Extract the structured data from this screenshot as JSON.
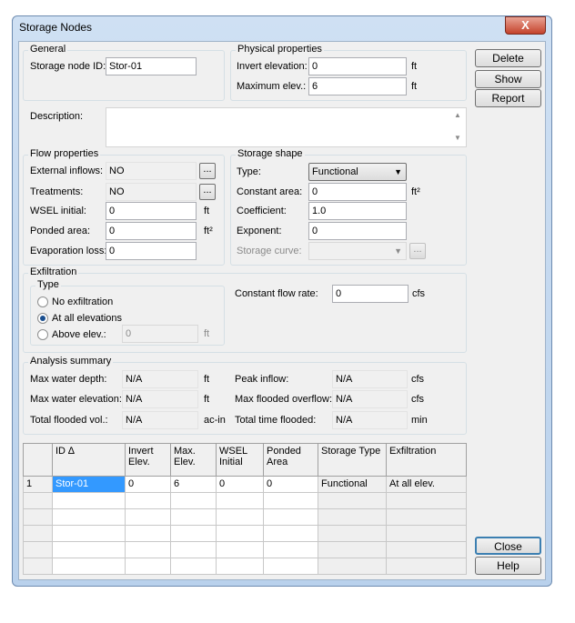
{
  "window": {
    "title": "Storage Nodes",
    "close": "X"
  },
  "general": {
    "legend": "General",
    "id_label": "Storage node ID:",
    "id_value": "Stor-01"
  },
  "physical": {
    "legend": "Physical properties",
    "invert_label": "Invert elevation:",
    "invert_value": "0",
    "invert_unit": "ft",
    "max_label": "Maximum elev.:",
    "max_value": "6",
    "max_unit": "ft"
  },
  "buttons": {
    "delete": "Delete",
    "show": "Show",
    "report": "Report",
    "close": "Close",
    "help": "Help",
    "ellipsis": "..."
  },
  "description": {
    "label": "Description:",
    "value": ""
  },
  "flow": {
    "legend": "Flow properties",
    "ext_label": "External inflows:",
    "ext_value": "NO",
    "treat_label": "Treatments:",
    "treat_value": "NO",
    "wsel_label": "WSEL initial:",
    "wsel_value": "0",
    "wsel_unit": "ft",
    "ponded_label": "Ponded area:",
    "ponded_value": "0",
    "ponded_unit": "ft²",
    "evap_label": "Evaporation loss:",
    "evap_value": "0"
  },
  "shape": {
    "legend": "Storage shape",
    "type_label": "Type:",
    "type_value": "Functional",
    "const_label": "Constant area:",
    "const_value": "0",
    "const_unit": "ft²",
    "coef_label": "Coefficient:",
    "coef_value": "1.0",
    "exp_label": "Exponent:",
    "exp_value": "0",
    "curve_label": "Storage curve:",
    "curve_value": ""
  },
  "exfil": {
    "legend": "Exfiltration",
    "type_legend": "Type",
    "options": [
      "No exfiltration",
      "At all elevations",
      "Above elev.:"
    ],
    "selected": 1,
    "above_value": "0",
    "above_unit": "ft",
    "rate_label": "Constant flow rate:",
    "rate_value": "0",
    "rate_unit": "cfs"
  },
  "summary": {
    "legend": "Analysis summary",
    "depth_label": "Max water depth:",
    "depth_value": "N/A",
    "depth_unit": "ft",
    "elev_label": "Max water elevation:",
    "elev_value": "N/A",
    "elev_unit": "ft",
    "vol_label": "Total flooded vol.:",
    "vol_value": "N/A",
    "vol_unit": "ac-in",
    "peak_label": "Peak inflow:",
    "peak_value": "N/A",
    "peak_unit": "cfs",
    "overflow_label": "Max flooded overflow:",
    "overflow_value": "N/A",
    "overflow_unit": "cfs",
    "time_label": "Total time flooded:",
    "time_value": "N/A",
    "time_unit": "min"
  },
  "grid": {
    "headers": [
      "",
      "ID ∆",
      "Invert Elev.",
      "Max. Elev.",
      "WSEL Initial",
      "Ponded Area",
      "Storage Type",
      "Exfiltration"
    ],
    "rows": [
      [
        "1",
        "Stor-01",
        "0",
        "6",
        "0",
        "0",
        "Functional",
        "At all elev."
      ]
    ],
    "empty_rows": 5
  }
}
